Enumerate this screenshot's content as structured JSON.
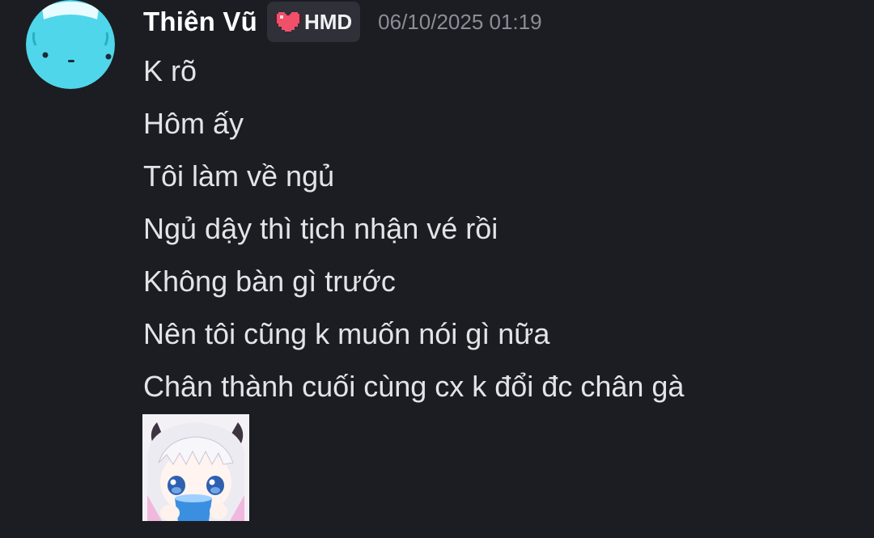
{
  "author": {
    "username": "Thiên Vũ",
    "tag": "HMD",
    "timestamp": "06/10/2025 01:19"
  },
  "messages": [
    "K rõ",
    "Hôm ấy",
    "Tôi làm về ngủ",
    "Ngủ dậy thì tịch nhận vé rồi",
    "Không bàn gì trước",
    "Nên tôi cũng k muốn nói gì nữa",
    "Chân thành cuối cùng cx k đổi đc chân gà"
  ],
  "icons": {
    "avatar": "cyan-blob-avatar",
    "tag_icon": "pixel-heart-icon",
    "sticker": "anime-girl-drinking-sticker"
  },
  "colors": {
    "background": "#1c1d22",
    "avatar": "#4fd6ea",
    "tag_background": "#2f3038",
    "heart": "#f0506a",
    "timestamp": "#8c8d96"
  }
}
